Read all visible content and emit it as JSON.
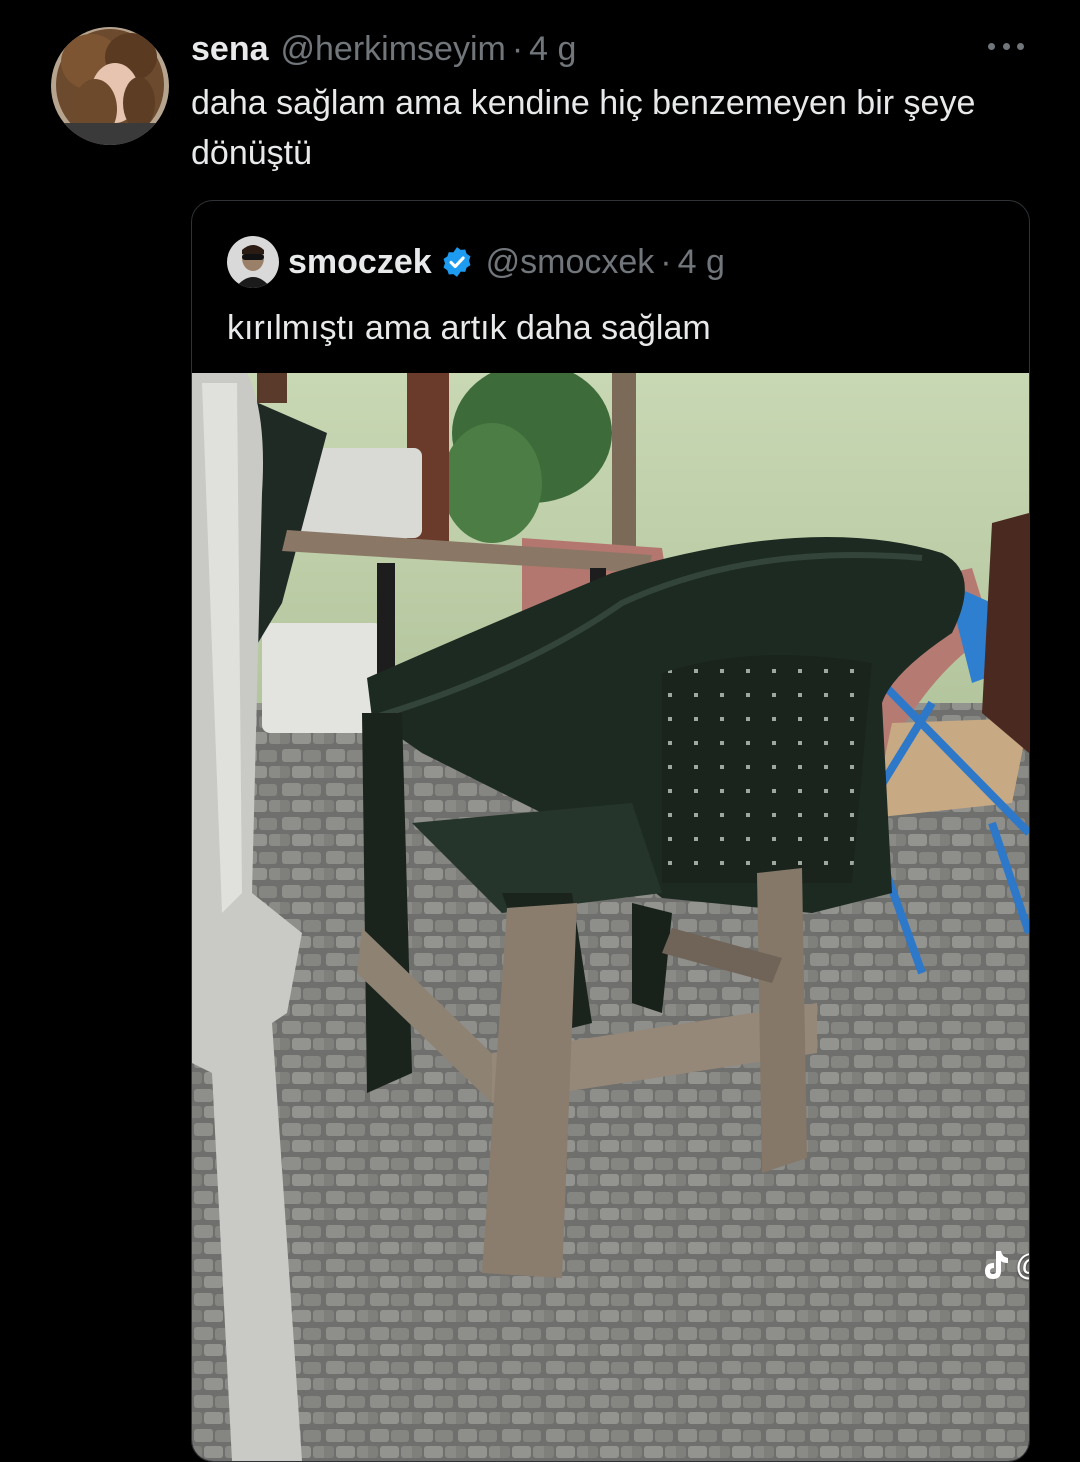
{
  "post": {
    "display_name": "sena",
    "handle": "@herkimseyim",
    "separator": "·",
    "time": "4 g",
    "text": "daha sağlam ama kendine hiç benzemeyen bir şeye dönüştü",
    "avatar_icon": "user-avatar-photo",
    "more_icon": "more-options-icon"
  },
  "quote": {
    "display_name": "smoczek",
    "verified_icon": "verified-badge-icon",
    "handle": "@smocxek",
    "separator": "·",
    "time": "4 g",
    "text": "kırılmıştı ama artık daha sağlam",
    "media_icon": "photo-green-chair-wooden-legs"
  },
  "watermark": {
    "icon": "tiktok-logo-icon",
    "text": "@baharcettinn"
  },
  "colors": {
    "background": "#000000",
    "text_primary": "#e7e9ea",
    "text_secondary": "#71767b",
    "border": "#2f3336",
    "verified_blue": "#1d9bf0"
  }
}
